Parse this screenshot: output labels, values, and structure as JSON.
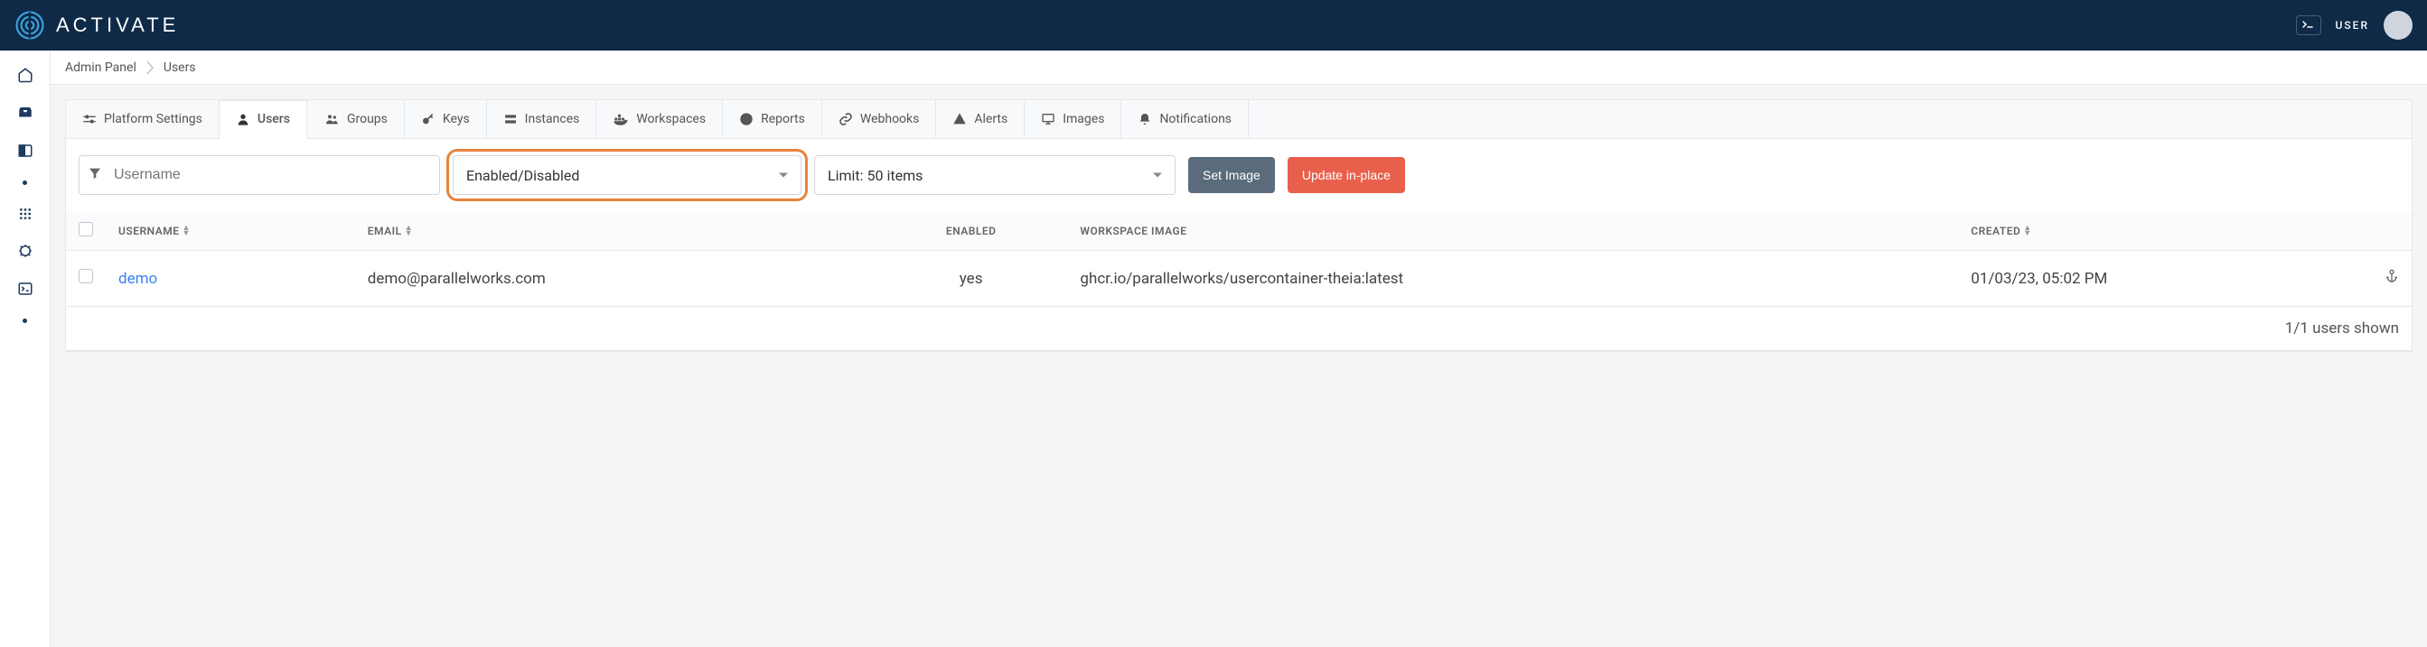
{
  "topbar": {
    "brand": "ACTIVATE",
    "user_label": "USER"
  },
  "breadcrumb": {
    "root": "Admin Panel",
    "current": "Users"
  },
  "tabs": [
    {
      "label": "Platform Settings",
      "icon": "sliders"
    },
    {
      "label": "Users",
      "icon": "user",
      "active": true
    },
    {
      "label": "Groups",
      "icon": "users"
    },
    {
      "label": "Keys",
      "icon": "key"
    },
    {
      "label": "Instances",
      "icon": "server"
    },
    {
      "label": "Workspaces",
      "icon": "docker"
    },
    {
      "label": "Reports",
      "icon": "pie"
    },
    {
      "label": "Webhooks",
      "icon": "link"
    },
    {
      "label": "Alerts",
      "icon": "alert"
    },
    {
      "label": "Images",
      "icon": "monitor"
    },
    {
      "label": "Notifications",
      "icon": "bell"
    }
  ],
  "filters": {
    "username_placeholder": "Username",
    "status_select": "Enabled/Disabled",
    "limit_select": "Limit: 50 items",
    "set_image_btn": "Set Image",
    "update_btn": "Update in-place"
  },
  "columns": {
    "username": "USERNAME",
    "email": "EMAIL",
    "enabled": "ENABLED",
    "workspace_image": "WORKSPACE IMAGE",
    "created": "CREATED"
  },
  "rows": [
    {
      "username": "demo",
      "email": "demo@parallelworks.com",
      "enabled": "yes",
      "workspace_image": "ghcr.io/parallelworks/usercontainer-theia:latest",
      "created": "01/03/23, 05:02 PM"
    }
  ],
  "footer": "1/1 users shown"
}
